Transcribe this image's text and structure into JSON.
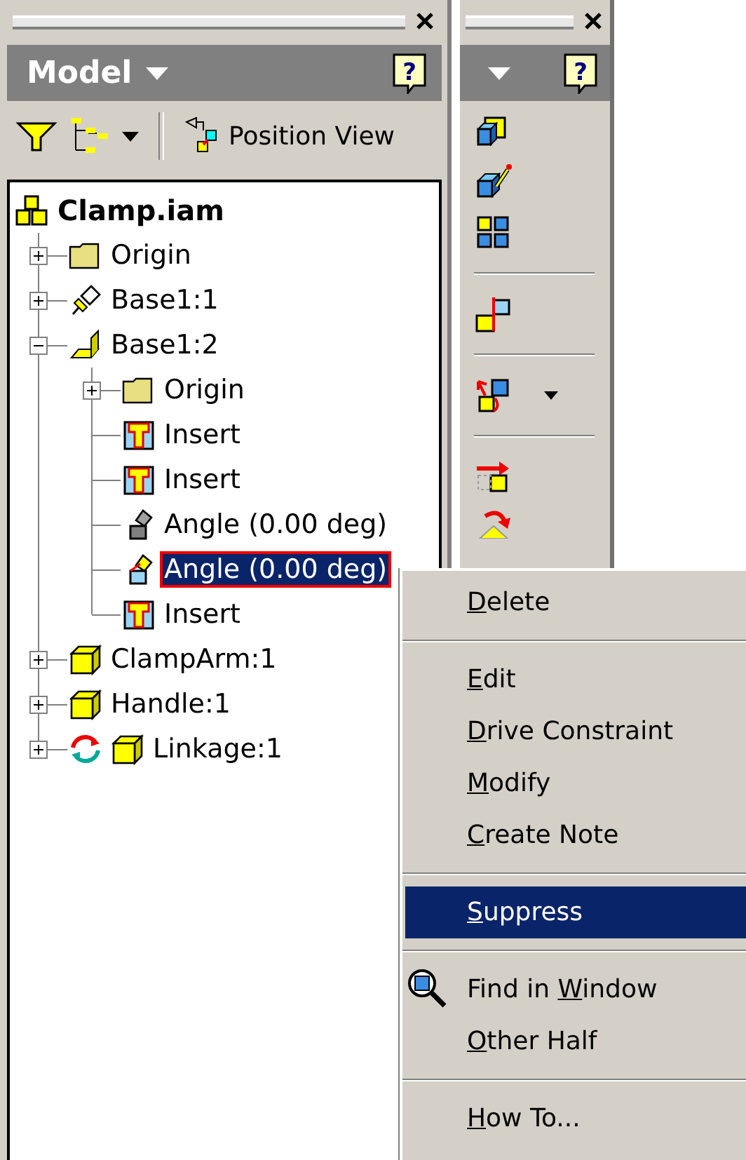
{
  "model_panel": {
    "title": "Model",
    "help": "?",
    "toolbar": {
      "position_view": "Position View"
    }
  },
  "tools_panel": {
    "help": "?"
  },
  "tree": {
    "label": "Clamp.iam",
    "kind": "assembly",
    "selected": false,
    "children": [
      {
        "label": "Origin",
        "kind": "folder",
        "expanded": false,
        "selected": false
      },
      {
        "label": "Base1:1",
        "kind": "grounded-part",
        "expanded": false,
        "selected": false
      },
      {
        "label": "Base1:2",
        "kind": "angle-part",
        "expanded": true,
        "selected": false,
        "children": [
          {
            "label": "Origin",
            "kind": "folder",
            "expanded": false,
            "selected": false
          },
          {
            "label": "Insert",
            "kind": "insert",
            "selected": false
          },
          {
            "label": "Insert",
            "kind": "insert",
            "selected": false
          },
          {
            "label": "Angle (0.00 deg)",
            "kind": "angle",
            "selected": false
          },
          {
            "label": "Angle (0.00 deg)",
            "kind": "angle-active",
            "selected": true
          },
          {
            "label": "Insert",
            "kind": "insert",
            "selected": false
          }
        ]
      },
      {
        "label": "ClampArm:1",
        "kind": "part",
        "expanded": false,
        "selected": false
      },
      {
        "label": "Handle:1",
        "kind": "part",
        "expanded": false,
        "selected": false
      },
      {
        "label": "Linkage:1",
        "kind": "driven-part",
        "expanded": false,
        "selected": false
      }
    ]
  },
  "context_menu": {
    "groups": [
      [
        {
          "kind": "plain",
          "key": "D",
          "after": "elete",
          "selected": false
        }
      ],
      [
        {
          "kind": "plain",
          "key": "E",
          "after": "dit",
          "selected": false
        },
        {
          "kind": "plain",
          "key": "D",
          "after": "rive Constraint",
          "selected": false
        },
        {
          "kind": "plain",
          "key": "M",
          "after": "odify",
          "selected": false
        },
        {
          "kind": "plain",
          "key": "C",
          "after": "reate Note",
          "selected": false
        }
      ],
      [
        {
          "kind": "plain",
          "key": "S",
          "after": "uppress",
          "selected": true
        }
      ],
      [
        {
          "kind": "find",
          "before": "Find in ",
          "key": "W",
          "after": "indow",
          "selected": false
        },
        {
          "kind": "plain",
          "key": "O",
          "after": "ther Half",
          "selected": false
        }
      ],
      [
        {
          "kind": "plain",
          "key": "H",
          "after": "ow To...",
          "selected": false
        }
      ]
    ]
  }
}
